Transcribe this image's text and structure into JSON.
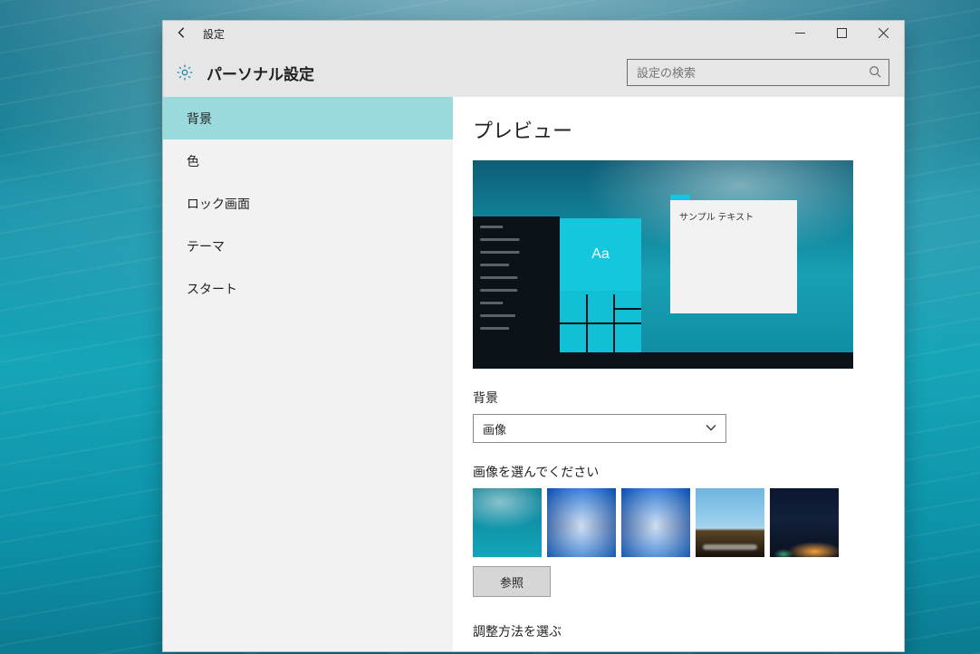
{
  "titlebar": {
    "back_aria": "戻る",
    "title": "設定"
  },
  "subheader": {
    "title": "パーソナル設定",
    "search_placeholder": "設定の検索"
  },
  "sidebar": {
    "items": [
      {
        "label": "背景",
        "active": true
      },
      {
        "label": "色"
      },
      {
        "label": "ロック画面"
      },
      {
        "label": "テーマ"
      },
      {
        "label": "スタート"
      }
    ]
  },
  "content": {
    "preview_heading": "プレビュー",
    "preview_sample_text": "サンプル テキスト",
    "preview_aa": "Aa",
    "background_label": "背景",
    "background_value": "画像",
    "choose_label": "画像を選んでください",
    "browse_label": "参照",
    "fit_label": "調整方法を選ぶ"
  }
}
